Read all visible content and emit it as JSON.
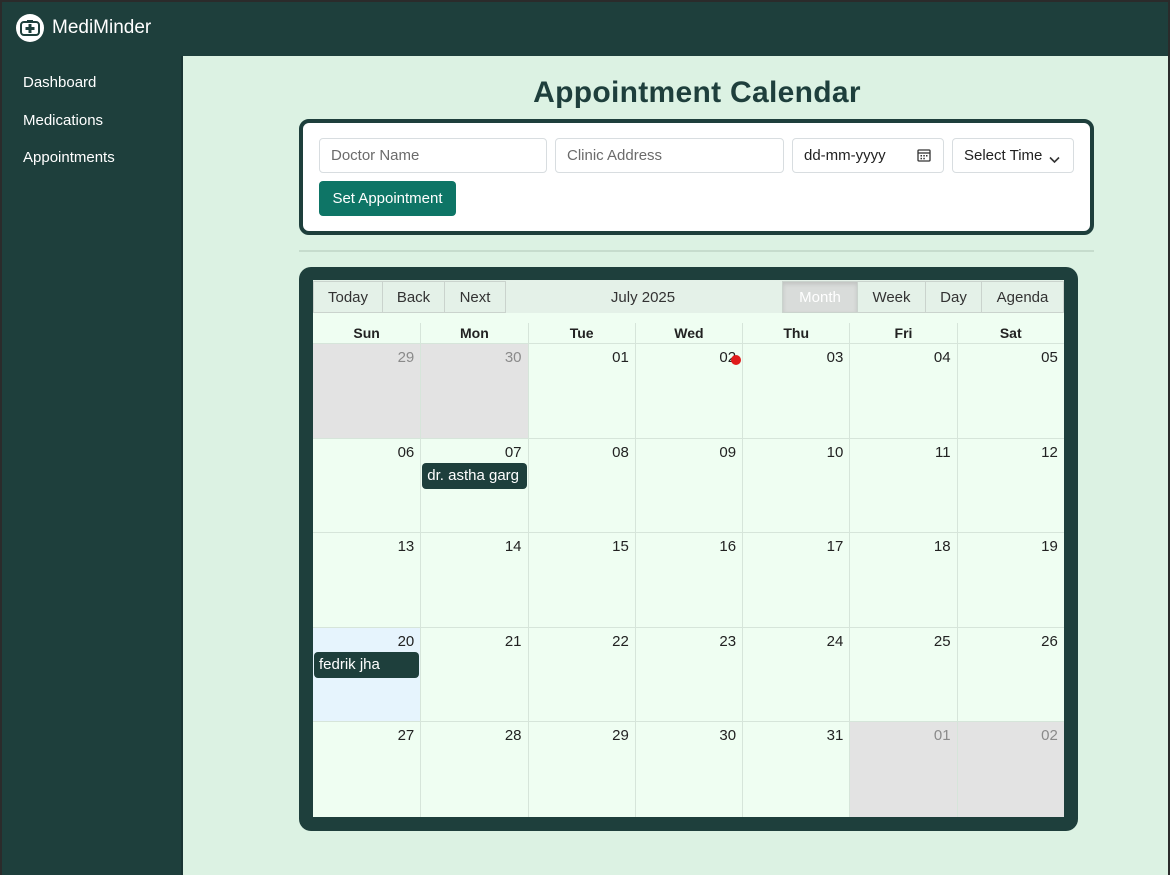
{
  "app": {
    "name": "MediMinder",
    "logo_icon": "medical-cross-icon"
  },
  "sidebar": {
    "items": [
      {
        "label": "Dashboard"
      },
      {
        "label": "Medications"
      },
      {
        "label": "Appointments"
      }
    ]
  },
  "page": {
    "title": "Appointment Calendar"
  },
  "form": {
    "doctor_placeholder": "Doctor Name",
    "clinic_placeholder": "Clinic Address",
    "date_placeholder": "dd-mm-yyyy",
    "time_placeholder": "Select Time",
    "submit_label": "Set Appointment"
  },
  "calendar": {
    "toolbar": {
      "today": "Today",
      "back": "Back",
      "next": "Next",
      "label": "July 2025",
      "views": [
        "Month",
        "Week",
        "Day",
        "Agenda"
      ],
      "active_view": "Month"
    },
    "days_of_week": [
      "Sun",
      "Mon",
      "Tue",
      "Wed",
      "Thu",
      "Fri",
      "Sat"
    ],
    "weeks": [
      [
        {
          "d": "29",
          "off": true
        },
        {
          "d": "30",
          "off": true
        },
        {
          "d": "01"
        },
        {
          "d": "02"
        },
        {
          "d": "03"
        },
        {
          "d": "04"
        },
        {
          "d": "05"
        }
      ],
      [
        {
          "d": "06"
        },
        {
          "d": "07",
          "event": "dr. astha garg"
        },
        {
          "d": "08"
        },
        {
          "d": "09"
        },
        {
          "d": "10"
        },
        {
          "d": "11"
        },
        {
          "d": "12"
        }
      ],
      [
        {
          "d": "13"
        },
        {
          "d": "14"
        },
        {
          "d": "15"
        },
        {
          "d": "16"
        },
        {
          "d": "17"
        },
        {
          "d": "18"
        },
        {
          "d": "19"
        }
      ],
      [
        {
          "d": "20",
          "today": true,
          "event": "fedrik jha"
        },
        {
          "d": "21"
        },
        {
          "d": "22"
        },
        {
          "d": "23"
        },
        {
          "d": "24"
        },
        {
          "d": "25"
        },
        {
          "d": "26"
        }
      ],
      [
        {
          "d": "27"
        },
        {
          "d": "28"
        },
        {
          "d": "29"
        },
        {
          "d": "30"
        },
        {
          "d": "31"
        },
        {
          "d": "01",
          "off": true
        },
        {
          "d": "02",
          "off": true
        }
      ]
    ]
  },
  "colors": {
    "sidebar_bg": "#1e3f3c",
    "page_bg": "#dcf2e3",
    "accent": "#0e7566",
    "event_bg": "#1e3f3c",
    "marker": "#e01b1b"
  }
}
